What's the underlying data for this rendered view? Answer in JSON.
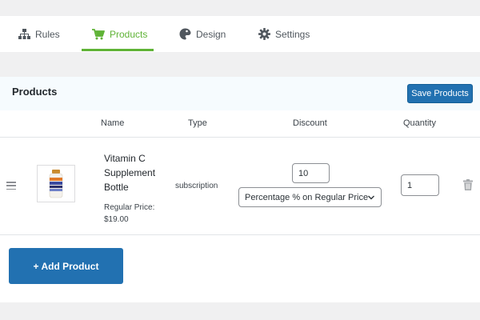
{
  "tabs": [
    {
      "label": "Rules",
      "icon": "sitemap-icon"
    },
    {
      "label": "Products",
      "icon": "cart-icon",
      "active": true
    },
    {
      "label": "Design",
      "icon": "palette-icon"
    },
    {
      "label": "Settings",
      "icon": "gear-icon"
    }
  ],
  "panel": {
    "title": "Products",
    "save_label": "Save Products"
  },
  "columns": {
    "name": "Name",
    "type": "Type",
    "discount": "Discount",
    "quantity": "Quantity"
  },
  "product": {
    "name": "Vitamin C Supplement Bottle",
    "price_label": "Regular Price:",
    "price": "$19.00",
    "type": "subscription",
    "discount_value": "10",
    "discount_mode": "Percentage % on Regular Price",
    "quantity": "1"
  },
  "add_label": "+ Add Product",
  "colors": {
    "accent": "#5fb336",
    "primary": "#2271b1"
  }
}
